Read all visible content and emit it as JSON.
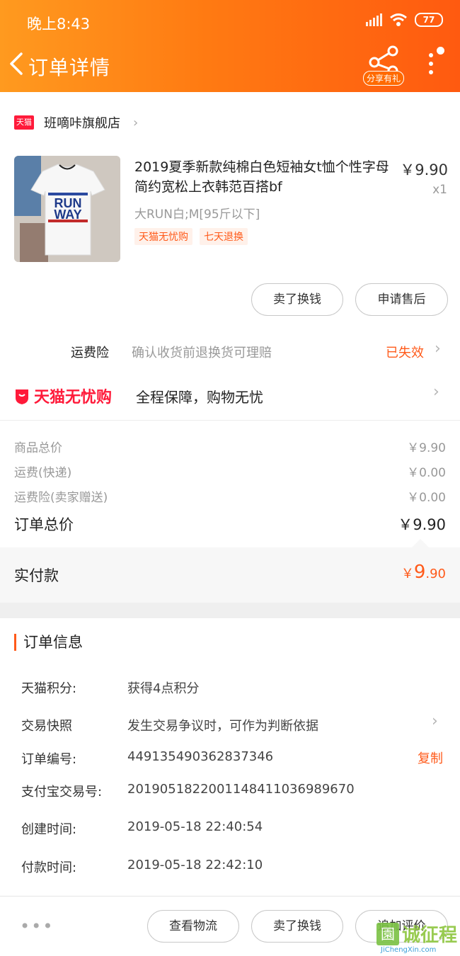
{
  "status_bar": {
    "time": "晚上8:43",
    "battery": "77"
  },
  "nav": {
    "title": "订单详情",
    "share_label": "分享有礼"
  },
  "shop": {
    "badge": "天猫",
    "name": "班嘀咔旗舰店"
  },
  "product": {
    "title": "2019夏季新款纯棉白色短袖女t恤个性字母简约宽松上衣韩范百搭bf",
    "price": "￥9.90",
    "qty": "x1",
    "sku": "大RUN白;M[95斤以下]",
    "tags": [
      "天猫无忧购",
      "七天退换"
    ],
    "image_text_1": "RUN",
    "image_text_2": "WAY"
  },
  "item_actions": {
    "sell_exchange": "卖了换钱",
    "after_sale": "申请售后"
  },
  "freight_insurance": {
    "name": "运费险",
    "desc": "确认收货前退换货可理赔",
    "status": "已失效"
  },
  "worry_free": {
    "brand": "天猫无忧购",
    "desc": "全程保障，购物无忧"
  },
  "prices": {
    "rows": [
      {
        "label": "商品总价",
        "value": "￥9.90"
      },
      {
        "label": "运费(快递)",
        "value": "￥0.00"
      },
      {
        "label": "运费险(卖家赠送)",
        "value": "￥0.00"
      }
    ],
    "total_label": "订单总价",
    "total_value": "￥9.90",
    "paid_label": "实付款",
    "paid_currency": "￥",
    "paid_big": "9",
    "paid_small": ".90"
  },
  "order_info": {
    "title": "订单信息",
    "rows": [
      {
        "label": "天猫积分:",
        "value": "获得4点积分"
      },
      {
        "label": "交易快照",
        "value": "发生交易争议时，可作为判断依据"
      },
      {
        "label": "订单编号:",
        "value": "449135490362837346"
      },
      {
        "label": "支付宝交易号:",
        "value": "2019051822001148411036989670"
      },
      {
        "label": "创建时间:",
        "value": "2019-05-18 22:40:54"
      },
      {
        "label": "付款时间:",
        "value": "2019-05-18 22:42:10"
      }
    ],
    "copy_label": "复制"
  },
  "bottom_bar": {
    "more": "•••",
    "logistics": "查看物流",
    "sell_exchange": "卖了换钱",
    "review": "追加评价"
  },
  "watermark": {
    "icon_text": "園",
    "text": "诚征程",
    "url": "JiChengXin.com"
  },
  "colors": {
    "accent": "#ff5a1a",
    "header_start": "#ff9a1f",
    "header_end": "#ff5a10",
    "tmall_red": "#ff1a3a"
  }
}
